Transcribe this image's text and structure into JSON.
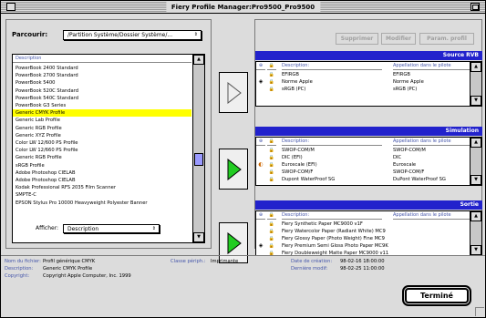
{
  "window": {
    "title": "Fiery Profile Manager:Pro9500_Pro9500"
  },
  "browse": {
    "label": "Parcourir:",
    "path": "/Partition Système/Dossier Système/...",
    "list_header": "Description",
    "items": [
      "PowerBook 2400 Standard",
      "PowerBook 2700 Standard",
      "PowerBook 5400",
      "PowerBook 520C Standard",
      "PowerBook 540C Standard",
      "PowerBook G3 Series",
      "Generic CMYK Profile",
      "Generic Lab Profile",
      "Generic RGB Profile",
      "Generic XYZ Profile",
      "Color LW 12/600 PS Profile",
      "Color LW 12/660 PS Profile",
      "Generic RGB Profile",
      "sRGB Profile",
      "Adobe Photoshop CIELAB",
      "Adobe Photoshop CIELAB",
      "Kodak Professional RFS 2035 Film Scanner",
      "SMPTE-C",
      "EPSON Stylus Pro 10000 Heavyweight Polyester Banner"
    ],
    "selected_index": 6,
    "show_label": "Afficher:",
    "show_value": "Description"
  },
  "toolbar": {
    "delete_label": "Supprimer",
    "edit_label": "Modifier",
    "settings_label": "Param. profil"
  },
  "sections": {
    "source": {
      "title": "Source RVB",
      "col_desc": "Description:",
      "col_name": "Appellation dans le pilote",
      "rows": [
        {
          "desc": "EFIRGB",
          "name": "EFIRGB",
          "marker": "",
          "default": true
        },
        {
          "desc": "Norme Apple",
          "name": "Norme Apple",
          "marker": "◈",
          "default": true
        },
        {
          "desc": "sRGB (PC)",
          "name": "sRGB (PC)",
          "marker": "",
          "default": true
        }
      ]
    },
    "simulation": {
      "title": "Simulation",
      "col_desc": "Description:",
      "col_name": "Appellation dans le pilote",
      "rows": [
        {
          "desc": "SWOP-COM/M",
          "name": "SWOP-COM/M",
          "marker": "",
          "default": true
        },
        {
          "desc": "DIC (EFI)",
          "name": "DIC",
          "marker": "",
          "default": true
        },
        {
          "desc": "Euroscale (EFI)",
          "name": "Euroscale",
          "marker": "◐",
          "default": true
        },
        {
          "desc": "SWOP-COM/F",
          "name": "SWOP-COM/F",
          "marker": "",
          "default": true
        },
        {
          "desc": "Dupont WaterProof SG",
          "name": "DuPont WaterProof SG",
          "marker": "",
          "default": true
        }
      ]
    },
    "output": {
      "title": "Sortie",
      "col_desc": "Description:",
      "col_name": "Appellation dans le pilote",
      "rows": [
        {
          "desc": "Fiery Synthetic Paper MC9000 v1F",
          "name": "",
          "marker": "",
          "default": true
        },
        {
          "desc": "Fiery Watercolor Paper (Radiant White) MC9",
          "name": "",
          "marker": "",
          "default": true
        },
        {
          "desc": "Fiery Glossy Paper (Photo Weight) Fine MC9",
          "name": "",
          "marker": "",
          "default": true
        },
        {
          "desc": "Fiery Premium Semi Gloss Photo Paper MC9K",
          "name": "",
          "marker": "◈",
          "default": true
        },
        {
          "desc": "Fiery Doubleweight Matte Paper MC9000 v11",
          "name": "",
          "marker": "",
          "default": true
        }
      ]
    }
  },
  "info": {
    "filename_label": "Nom du fichier:",
    "filename_value": "Profil générique CMYK",
    "description_label": "Description:",
    "description_value": "Generic CMYK Profile",
    "copyright_label": "Copyright:",
    "copyright_value": "Copyright Apple Computer, Inc. 1999",
    "device_class_label": "Classe périph.:",
    "device_class_value": "Imprimante",
    "created_label": "Date de création:",
    "created_value": "98-02-16 18:00:00",
    "modified_label": "Dernière modif:",
    "modified_value": "98-02-25 11:00:00"
  },
  "done_label": "Terminé"
}
